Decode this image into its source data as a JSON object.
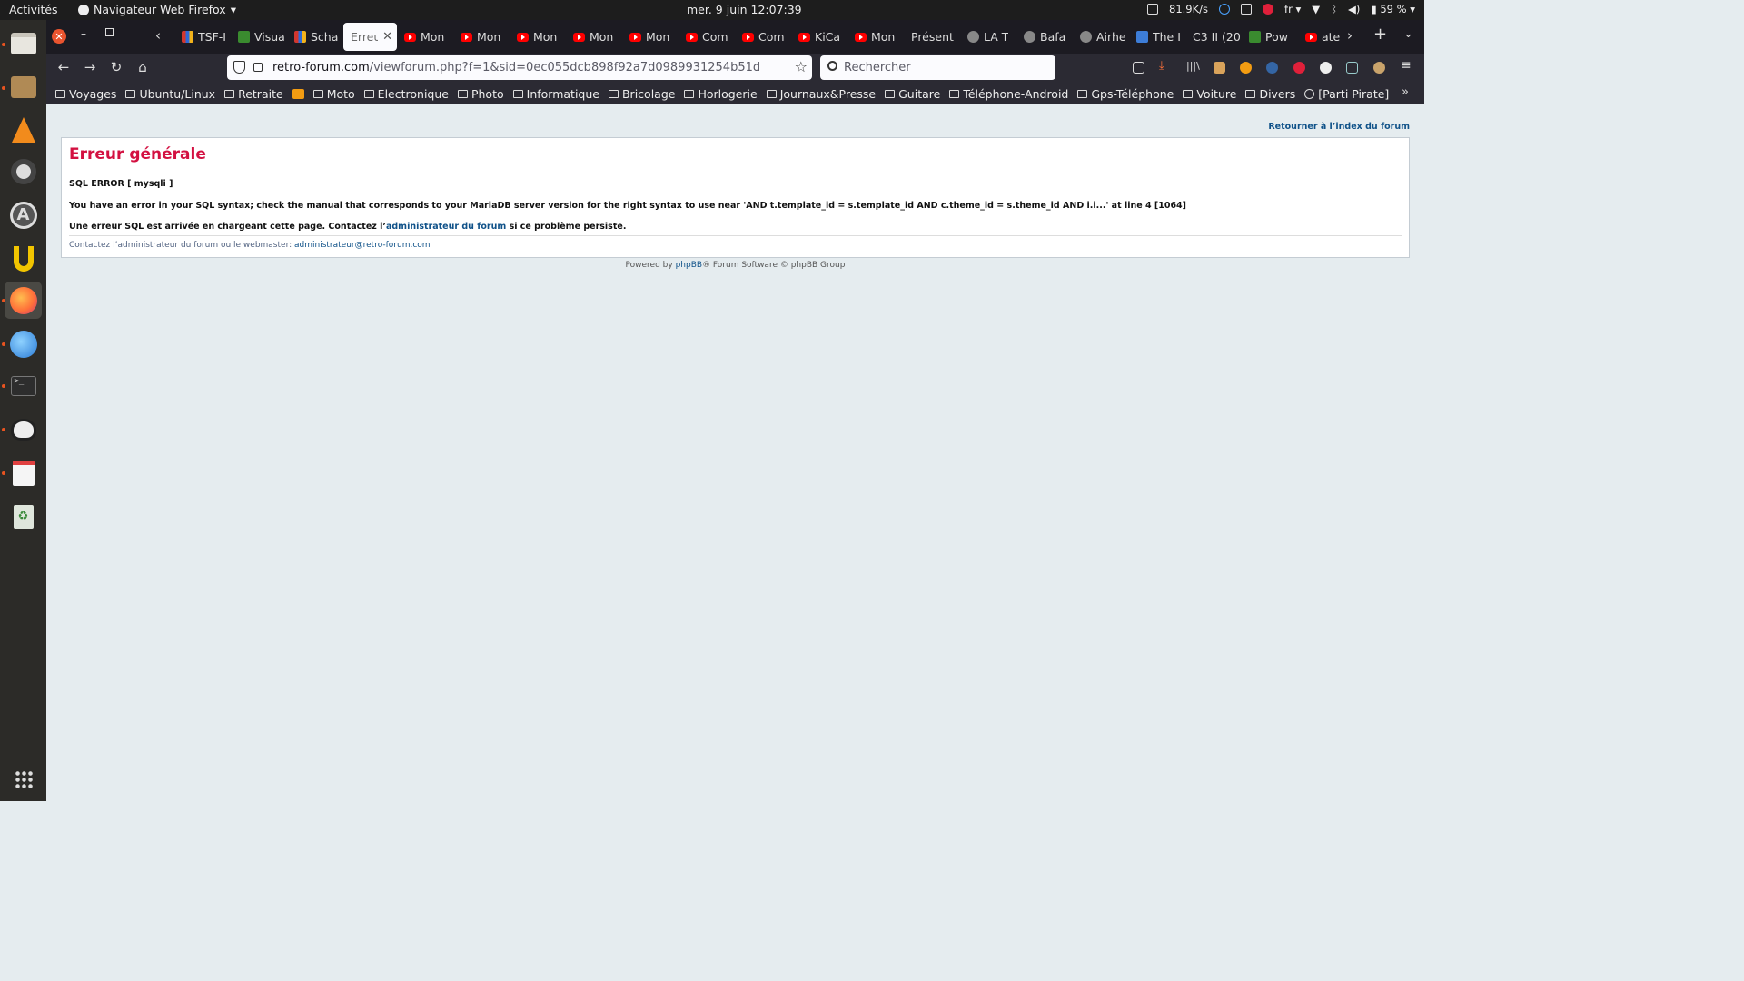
{
  "topbar": {
    "activities": "Activités",
    "app_name": "Navigateur Web Firefox",
    "clock": "mer. 9 juin  12:07:39",
    "net_speed": "81.9K/s",
    "keyboard": "fr",
    "battery": "59 %"
  },
  "tabs": [
    {
      "label": "TSF-I",
      "icon": "multi"
    },
    {
      "label": "Visua",
      "icon": "green"
    },
    {
      "label": "Scha",
      "icon": "multi"
    },
    {
      "label": "Erreur",
      "icon": "none",
      "selected": true
    },
    {
      "label": "Mon",
      "icon": "yt"
    },
    {
      "label": "Mon",
      "icon": "yt"
    },
    {
      "label": "Mon",
      "icon": "yt"
    },
    {
      "label": "Mon",
      "icon": "yt"
    },
    {
      "label": "Mon",
      "icon": "yt"
    },
    {
      "label": "Com",
      "icon": "yt"
    },
    {
      "label": "Com",
      "icon": "yt"
    },
    {
      "label": "KiCa",
      "icon": "yt"
    },
    {
      "label": "Mon",
      "icon": "yt"
    },
    {
      "label": "Présent",
      "icon": "none"
    },
    {
      "label": "LA T",
      "icon": "gray"
    },
    {
      "label": "Bafa",
      "icon": "gray"
    },
    {
      "label": "Airhe",
      "icon": "gray"
    },
    {
      "label": "The I",
      "icon": "blue"
    },
    {
      "label": "C3 II (20",
      "icon": "none"
    },
    {
      "label": "Pow",
      "icon": "green"
    },
    {
      "label": "ate",
      "icon": "yt"
    }
  ],
  "nav": {
    "url_domain": "retro-forum.com",
    "url_path": "/viewforum.php?f=1&sid=0ec055dcb898f92a7d0989931254b51d",
    "search_placeholder": "Rechercher"
  },
  "bookmarks": [
    {
      "label": "Voyages",
      "icon": "folder"
    },
    {
      "label": "Ubuntu/Linux",
      "icon": "folder"
    },
    {
      "label": "Retraite",
      "icon": "folder"
    },
    {
      "label": "",
      "icon": "rss"
    },
    {
      "label": "Moto",
      "icon": "folder"
    },
    {
      "label": "Electronique",
      "icon": "folder"
    },
    {
      "label": "Photo",
      "icon": "folder"
    },
    {
      "label": "Informatique",
      "icon": "folder"
    },
    {
      "label": "Bricolage",
      "icon": "folder"
    },
    {
      "label": "Horlogerie",
      "icon": "folder"
    },
    {
      "label": "Journaux&Presse",
      "icon": "folder"
    },
    {
      "label": "Guitare",
      "icon": "folder"
    },
    {
      "label": "Téléphone-Android",
      "icon": "folder"
    },
    {
      "label": "Gps-Téléphone",
      "icon": "folder"
    },
    {
      "label": "Voiture",
      "icon": "folder"
    },
    {
      "label": "Divers",
      "icon": "folder"
    },
    {
      "label": "[Parti Pirate]",
      "icon": "globe"
    }
  ],
  "page": {
    "back_link": "Retourner à l’index du forum",
    "title": "Erreur générale",
    "sql_error": "SQL ERROR [ mysqli ]",
    "error_message": "You have an error in your SQL syntax; check the manual that corresponds to your MariaDB server version for the right syntax to use near 'AND t.template_id = s.template_id AND c.theme_id = s.theme_id AND i.i...' at line 4 [1064]",
    "info_prefix": "Une erreur SQL est arrivée en chargeant cette page. Contactez l’",
    "info_link": "administrateur du forum",
    "info_suffix": " si ce problème persiste.",
    "contact_prefix": "Contactez l’administrateur du forum ou le webmaster: ",
    "contact_email": "administrateur@retro-forum.com",
    "powered_prefix": "Powered by ",
    "powered_link": "phpBB",
    "powered_suffix": "® Forum Software © phpBB Group"
  },
  "colors": {
    "error_title": "#d31141",
    "link": "#105289",
    "page_bg": "#e5ecef"
  }
}
